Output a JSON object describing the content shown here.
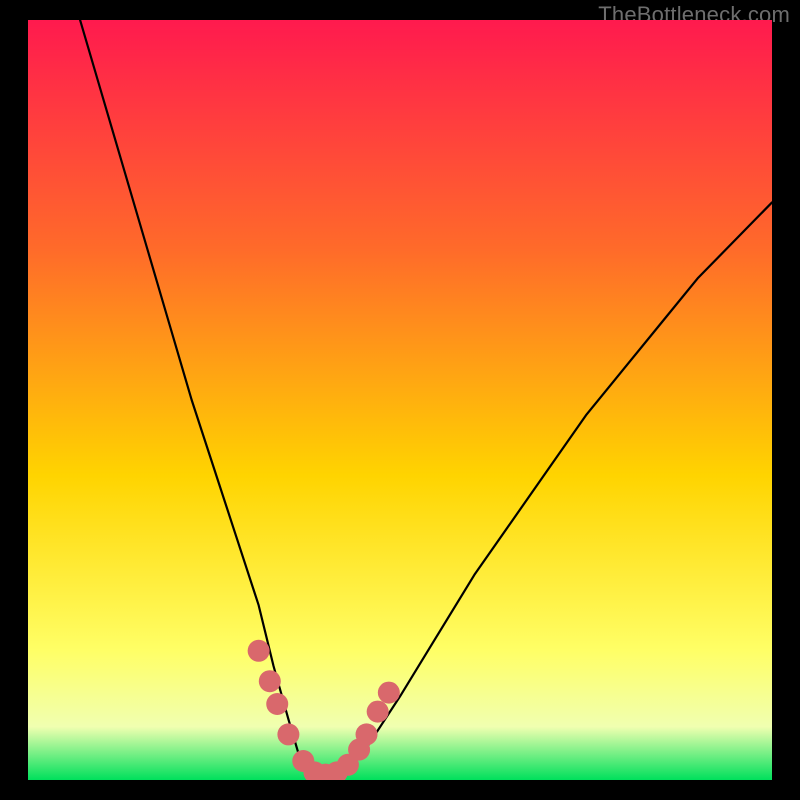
{
  "watermark": "TheBottleneck.com",
  "colors": {
    "frame": "#000000",
    "gradient_top": "#ff1a4e",
    "gradient_mid1": "#ff6a2a",
    "gradient_mid2": "#ffd400",
    "gradient_low": "#ffff66",
    "gradient_pale": "#f0ffb0",
    "gradient_green": "#00e05c",
    "curve": "#000000",
    "marker": "#d9686c"
  },
  "chart_data": {
    "type": "line",
    "title": "",
    "xlabel": "",
    "ylabel": "",
    "xlim": [
      0,
      100
    ],
    "ylim": [
      0,
      100
    ],
    "series": [
      {
        "name": "bottleneck-curve",
        "x": [
          7,
          10,
          13,
          16,
          19,
          22,
          25,
          28,
          31,
          33,
          35,
          36.5,
          38,
          40,
          42,
          45,
          50,
          55,
          60,
          65,
          70,
          75,
          80,
          85,
          90,
          95,
          100
        ],
        "y": [
          100,
          90,
          80,
          70,
          60,
          50,
          41,
          32,
          23,
          15,
          8,
          3,
          1,
          0.5,
          1,
          3.5,
          11,
          19,
          27,
          34,
          41,
          48,
          54,
          60,
          66,
          71,
          76
        ]
      }
    ],
    "markers": [
      {
        "name": "low-region-markers",
        "x": [
          31,
          32.5,
          33.5,
          35,
          37,
          38.5,
          40,
          41.5,
          43,
          44.5,
          45.5,
          47,
          48.5
        ],
        "y": [
          17,
          13,
          10,
          6,
          2.5,
          1,
          0.7,
          1,
          2,
          4,
          6,
          9,
          11.5
        ]
      }
    ]
  }
}
